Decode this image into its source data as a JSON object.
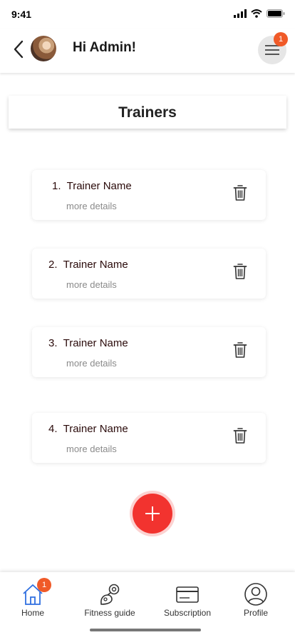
{
  "status_bar": {
    "time": "9:41"
  },
  "header": {
    "greeting": "Hi Admin!",
    "menu_badge": "1"
  },
  "page": {
    "title": "Trainers"
  },
  "trainers": [
    {
      "number": "1.",
      "name": "Trainer Name",
      "details": "more details"
    },
    {
      "number": "2.",
      "name": "Trainer Name",
      "details": "more details"
    },
    {
      "number": "3.",
      "name": "Trainer Name",
      "details": "more details"
    },
    {
      "number": "4.",
      "name": "Trainer Name",
      "details": "more details"
    }
  ],
  "bottom_nav": {
    "items": [
      {
        "label": "Home",
        "icon": "home-icon",
        "badge": "1",
        "active": true
      },
      {
        "label": "Fitness guide",
        "icon": "dumbbell-arm-icon"
      },
      {
        "label": "Subscription",
        "icon": "credit-card-icon"
      },
      {
        "label": "Profile",
        "icon": "user-icon"
      }
    ]
  },
  "colors": {
    "accent": "#f2332f",
    "badge": "#f05a28",
    "active_nav": "#2f6fe0"
  }
}
